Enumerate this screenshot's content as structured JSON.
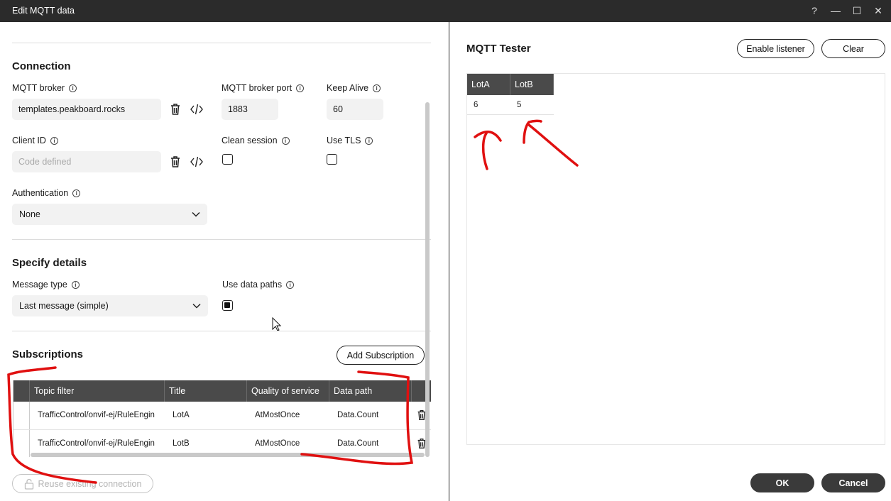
{
  "window": {
    "title": "Edit MQTT data",
    "controls": [
      "?",
      "—",
      "☐",
      "✕"
    ]
  },
  "connection": {
    "heading": "Connection",
    "broker_label": "MQTT broker",
    "broker_value": "templates.peakboard.rocks",
    "port_label": "MQTT broker port",
    "port_value": "1883",
    "keepalive_label": "Keep Alive",
    "keepalive_value": "60",
    "clientid_label": "Client ID",
    "clientid_placeholder": "Code defined",
    "clean_session_label": "Clean session",
    "clean_session_checked": false,
    "use_tls_label": "Use TLS",
    "use_tls_checked": false,
    "auth_label": "Authentication",
    "auth_value": "None"
  },
  "details": {
    "heading": "Specify details",
    "message_type_label": "Message type",
    "message_type_value": "Last message (simple)",
    "use_data_paths_label": "Use data paths",
    "use_data_paths_checked": true
  },
  "subscriptions": {
    "heading": "Subscriptions",
    "add_button": "Add Subscription",
    "columns": [
      "Topic filter",
      "Title",
      "Quality of service",
      "Data path"
    ],
    "rows": [
      {
        "topic": "TrafficControl/onvif-ej/RuleEngin",
        "title": "LotA",
        "qos": "AtMostOnce",
        "path": "Data.Count"
      },
      {
        "topic": "TrafficControl/onvif-ej/RuleEngin",
        "title": "LotB",
        "qos": "AtMostOnce",
        "path": "Data.Count"
      }
    ]
  },
  "reuse_button": "Reuse existing connection",
  "tester": {
    "title": "MQTT Tester",
    "enable_button": "Enable listener",
    "clear_button": "Clear",
    "columns": [
      "LotA",
      "LotB"
    ],
    "values": [
      "6",
      "5"
    ]
  },
  "footer": {
    "ok": "OK",
    "cancel": "Cancel"
  },
  "colors": {
    "titlebar": "#2b2b2b",
    "table_header": "#4a4a4a",
    "annotation": "#e01010"
  }
}
